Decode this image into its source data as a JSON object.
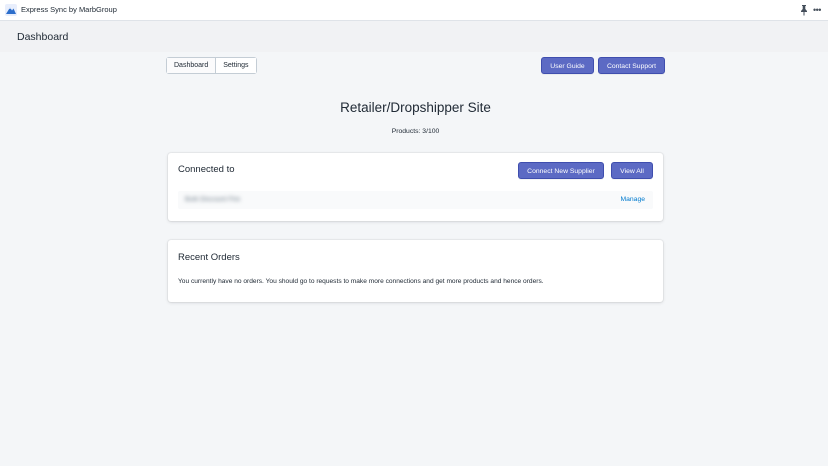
{
  "app": {
    "title": "Express Sync by MarbGroup",
    "logo_icon": "mountain-logo-icon",
    "pin_icon": "pin-icon",
    "more_icon": "more-horizontal-icon",
    "more_glyph": "•••"
  },
  "header": {
    "title": "Dashboard"
  },
  "tabs": [
    {
      "label": "Dashboard",
      "active": true
    },
    {
      "label": "Settings",
      "active": false
    }
  ],
  "actions": {
    "user_guide_label": "User Guide",
    "contact_support_label": "Contact Support"
  },
  "site": {
    "title": "Retailer/Dropshipper Site",
    "products_count": "Products: 3/100"
  },
  "connected": {
    "heading": "Connected to",
    "connect_label": "Connect New Supplier",
    "view_all_label": "View All",
    "suppliers": [
      {
        "name": "Bulk Discount Fire",
        "action": "Manage"
      }
    ]
  },
  "orders": {
    "heading": "Recent Orders",
    "empty_message": "You currently have no orders. You should go to requests to make more connections and get more products and hence orders."
  },
  "colors": {
    "primary": "#5c6ac4",
    "link": "#007ace",
    "background": "#f4f6f8"
  }
}
